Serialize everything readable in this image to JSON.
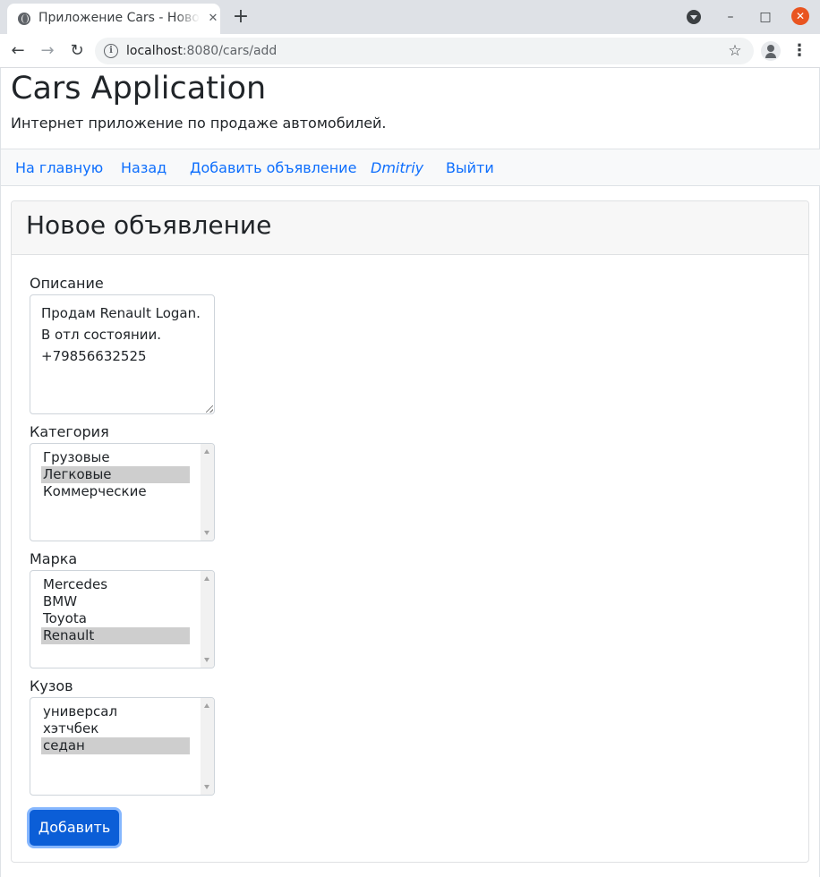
{
  "browser": {
    "tab_title": "Приложение Cars - Новое объявление",
    "tab_close_glyph": "✕",
    "new_tab_glyph": "+",
    "url_host": "localhost",
    "url_rest": ":8080/cars/add",
    "back_glyph": "←",
    "forward_glyph": "→",
    "reload_glyph": "↻",
    "info_glyph": "i",
    "star_glyph": "☆",
    "menu_glyph": "⋮",
    "minimize_glyph": "–",
    "maximize_glyph": "□",
    "close_glyph": "✕"
  },
  "header": {
    "title": "Cars Application",
    "subtitle": "Интернет приложение по продаже автомобилей."
  },
  "nav": {
    "home": "На главную",
    "back": "Назад",
    "add": "Добавить объявление",
    "user": "Dmitriy",
    "logout": "Выйти"
  },
  "form": {
    "title": "Новое объявление",
    "description_label": "Описание",
    "description_lines": [
      "Продам Renault Logan.",
      "В отл состоянии.",
      "+79856632525"
    ],
    "category": {
      "label": "Категория",
      "options": [
        "Грузовые",
        "Легковые",
        "Коммерческие"
      ],
      "selected": "Легковые"
    },
    "brand": {
      "label": "Марка",
      "options": [
        "Mercedes",
        "BMW",
        "Toyota",
        "Renault"
      ],
      "selected": "Renault"
    },
    "body": {
      "label": "Кузов",
      "options": [
        "универсал",
        "хэтчбек",
        "седан"
      ],
      "selected": "седан"
    },
    "submit": "Добавить"
  },
  "colors": {
    "link": "#0d6efd",
    "primary_button": "#0b5ed7",
    "selected_option": "#cecece"
  }
}
